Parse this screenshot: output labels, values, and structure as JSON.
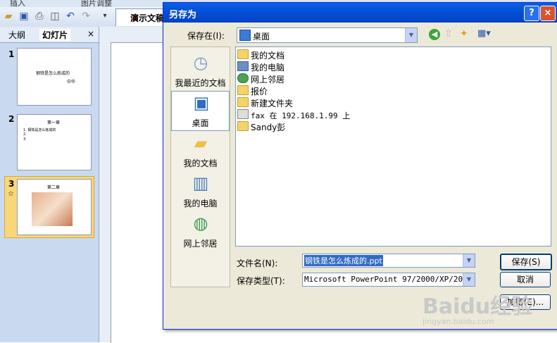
{
  "app": {
    "ribbon_tabs": [
      "插入",
      "图片调整"
    ],
    "doc_tab_label": "演示文稿",
    "panel_tabs": {
      "outline": "大纲",
      "slides": "幻灯片",
      "close": "×"
    },
    "slides": [
      {
        "num": "1",
        "title": "钢铁是怎么炼成的",
        "sub": "中华"
      },
      {
        "num": "2",
        "title": "第一章",
        "lines": [
          "1. 钢铁是怎么炼成的",
          "2.",
          "3."
        ]
      },
      {
        "num": "3",
        "title": "第二章"
      }
    ]
  },
  "dialog": {
    "title": "另存为",
    "help": "?",
    "close": "×",
    "save_in_label": "保存在(I):",
    "save_in_value": "桌面",
    "places": [
      "我最近的文档",
      "桌面",
      "我的文档",
      "我的电脑",
      "网上邻居"
    ],
    "files": [
      "我的文档",
      "我的电脑",
      "网上邻居",
      "报价",
      "新建文件夹",
      "fax 在 192.168.1.99 上",
      "Sandy彭"
    ],
    "filename_label": "文件名(N):",
    "filename_value": "钢铁是怎么炼成的.ppt",
    "filetype_label": "保存类型(T):",
    "filetype_value": "Microsoft PowerPoint 97/2000/XP/2003",
    "save_button": "保存(S)",
    "cancel_button": "取消",
    "encrypt_button": "加密(E)..."
  },
  "watermark": {
    "text": "Baidu经验",
    "sub": "jingyan.baidu.com"
  }
}
